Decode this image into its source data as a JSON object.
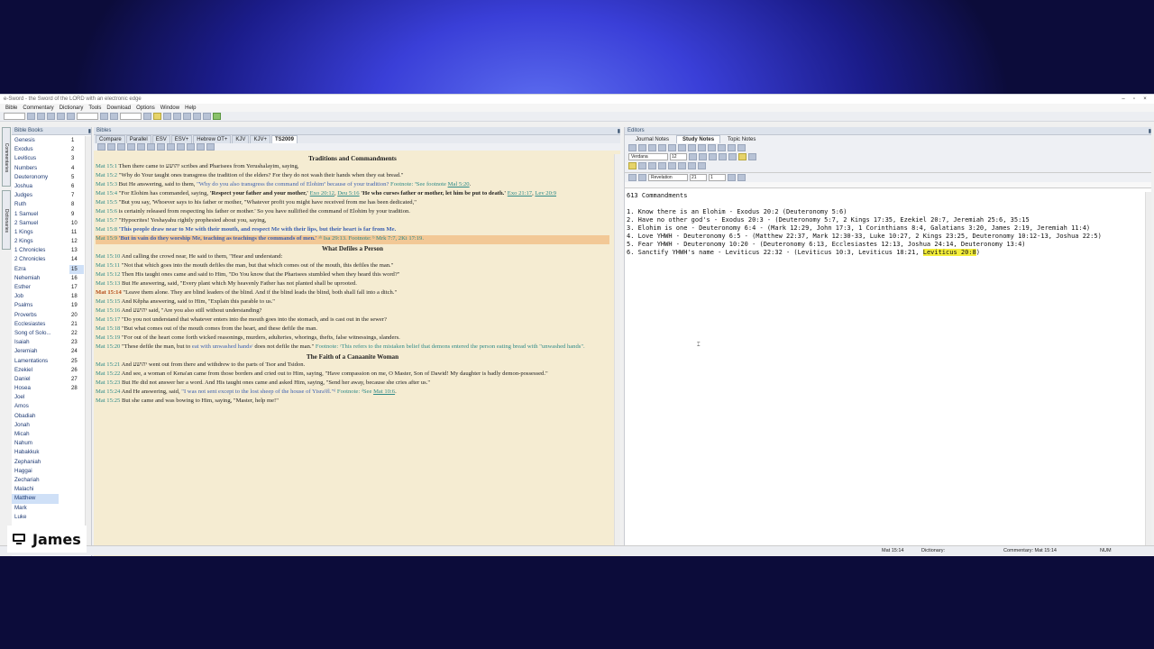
{
  "window": {
    "title": "e-Sword - the Sword of the LORD with an electronic edge"
  },
  "menu": [
    "Bible",
    "Commentary",
    "Dictionary",
    "Tools",
    "Download",
    "Options",
    "Window",
    "Help"
  ],
  "side_tabs": [
    "Commentaries",
    "Dictionaries"
  ],
  "books_panel": {
    "title": "Bible Books",
    "books": [
      "Genesis",
      "Exodus",
      "Leviticus",
      "Numbers",
      "Deuteronomy",
      "Joshua",
      "Judges",
      "Ruth",
      "1 Samuel",
      "2 Samuel",
      "1 Kings",
      "2 Kings",
      "1 Chronicles",
      "2 Chronicles",
      "Ezra",
      "Nehemiah",
      "Esther",
      "Job",
      "Psalms",
      "Proverbs",
      "Ecclesiastes",
      "Song of Solo...",
      "Isaiah",
      "Jeremiah",
      "Lamentations",
      "Ezekiel",
      "Daniel",
      "Hosea",
      "Joel",
      "Amos",
      "Obadiah",
      "Jonah",
      "Micah",
      "Nahum",
      "Habakkuk",
      "Zephaniah",
      "Haggai",
      "Zechariah",
      "Malachi",
      "Matthew",
      "Mark",
      "Luke"
    ],
    "selected_book": "Matthew",
    "chapters": [
      "1",
      "2",
      "3",
      "4",
      "5",
      "6",
      "7",
      "8",
      "9",
      "10",
      "11",
      "12",
      "13",
      "14",
      "15",
      "16",
      "17",
      "18",
      "19",
      "20",
      "21",
      "22",
      "23",
      "24",
      "25",
      "26",
      "27",
      "28"
    ],
    "selected_chapter": "15"
  },
  "bibles_panel": {
    "title": "Bibles",
    "tabs": [
      "Compare",
      "Parallel",
      "ESV",
      "ESV+",
      "Hebrew OT+",
      "KJV",
      "KJV+",
      "TS2009"
    ],
    "active_tab": "TS2009"
  },
  "passage": {
    "heading1": "Traditions and Commandments",
    "v1": {
      "ref": "Mat 15:1",
      "text": "Then there came to יהושע scribes and Pharisees from Yerushalayim, saying,"
    },
    "v2": {
      "ref": "Mat 15:2",
      "text": "\"Why do Your taught ones transgress the tradition of the elders? For they do not wash their hands when they eat bread.\""
    },
    "v3": {
      "ref": "Mat 15:3",
      "text": "But He answering, said to them,",
      "quote": "\"Why do you also transgress the command of Elohimª because of your tradition?",
      "fn_label": "Footnote:",
      "fn": "ªSee footnote",
      "fn_ref": "Mal 5:20",
      "fn_end": "."
    },
    "v4": {
      "ref": "Mat 15:4",
      "text": "\"For Elohim has commanded, saying,",
      "bold": "'Respect your father and your mother,'",
      "x1": "Exo 20:12",
      "x2": "Deu 5:16",
      "bold2": "'He who curses father or mother, let him be put to death.'",
      "x3": "Exo 21:17",
      "x4": "Lev 20:9"
    },
    "v5": {
      "ref": "Mat 15:5",
      "text": "\"But you say, 'Whoever says to his father or mother, \"Whatever profit you might have received from me has been dedicated,\""
    },
    "v6": {
      "ref": "Mat 15:6",
      "text": "is certainly released from respecting his father or mother.' So you have nullified the command of Elohim by your tradition."
    },
    "v7": {
      "ref": "Mat 15:7",
      "text": "\"Hypocrites! Yeshayahu rightly prophesied about you, saying,"
    },
    "v8": {
      "ref": "Mat 15:8",
      "text": "'This people draw near to Me with their mouth, and respect Me with their lips, but their heart is far from Me."
    },
    "v9": {
      "ref": "Mat 15:9",
      "text": "'But in vain do they worship Me, teaching as teachings the commands of men.'",
      "fn": "ᵃᵇ Isa 29:13. Footnote: ᵇ Mrk 7:7, 2Ki 17:19."
    },
    "heading2": "What Defiles a Person",
    "v10": {
      "ref": "Mat 15:10",
      "text": "And calling the crowd near, He said to them, \"Hear and understand:"
    },
    "v11": {
      "ref": "Mat 15:11",
      "text": "\"Not that which goes into the mouth defiles the man, but that which comes out of the mouth, this defiles the man.\""
    },
    "v12": {
      "ref": "Mat 15:12",
      "text": "Then His taught ones came and said to Him, \"Do You know that the Pharisees stumbled when they heard this word?\""
    },
    "v13": {
      "ref": "Mat 15:13",
      "text": "But He answering, said, \"Every plant which My heavenly Father has not planted shall be uprooted."
    },
    "v14": {
      "ref": "Mat 15:14",
      "text": "\"Leave them alone. They are blind leaders of the blind. And if the blind leads the blind, both shall fall into a ditch.\""
    },
    "v15": {
      "ref": "Mat 15:15",
      "text": "And Kĕpha answering, said to Him, \"Explain this parable to us.\""
    },
    "v16": {
      "ref": "Mat 15:16",
      "text": "And יהושע said, \"Are you also still without understanding?"
    },
    "v17": {
      "ref": "Mat 15:17",
      "text": "\"Do you not understand that whatever enters into the mouth goes into the stomach, and is cast out in the sewer?"
    },
    "v18": {
      "ref": "Mat 15:18",
      "text": "\"But what comes out of the mouth comes from the heart, and these defile the man."
    },
    "v19": {
      "ref": "Mat 15:19",
      "text": "\"For out of the heart come forth wicked reasonings, murders, adulteries, whorings, thefts, false witnessings, slanders."
    },
    "v20": {
      "ref": "Mat 15:20",
      "text": "\"These defile the man, but to",
      "blue": "eat with unwashed handsᶜ",
      "text2": "does not defile the man.\"",
      "fn": "Footnote: ᶜThis refers to the mistaken belief that demons entered the person eating bread with \"unwashed hands\"."
    },
    "heading3": "The Faith of a Canaanite Woman",
    "v21": {
      "ref": "Mat 15:21",
      "text": "And יהושע went out from there and withdrew to the parts of Tsor and Tsidon."
    },
    "v22": {
      "ref": "Mat 15:22",
      "text": "And see, a woman of Kena'an came from those borders and cried out to Him, saying, \"Have compassion on me, O Master, Son of Dawid! My daughter is badly demon-possessed.\""
    },
    "v23": {
      "ref": "Mat 15:23",
      "text": "But He did not answer her a word. And His taught ones came and asked Him, saying, \"Send her away, because she cries after us.\""
    },
    "v24": {
      "ref": "Mat 15:24",
      "text": "And He answering, said,",
      "blue": "\"I was not sent except to the lost sheep of the house of Yisra'ĕl.\"ᵈ",
      "fn": "Footnote: ᵈSee",
      "fn_ref": "Mat 10:6",
      "fn_end": "."
    },
    "v25": {
      "ref": "Mat 15:25",
      "text": "But she came and was bowing to Him, saying, \"Master, help me!\""
    }
  },
  "editors_panel": {
    "title": "Editors",
    "tabs": [
      "Journal Notes",
      "Study Notes",
      "Topic Notes"
    ],
    "active_tab": "Study Notes",
    "font": "Verdana",
    "font_size": "12",
    "book_select": "Revelation",
    "chapter_select": "21",
    "verse_select": "1",
    "notes_title": "613 Commandments",
    "notes": [
      "1. Know there is an Elohim - Exodus 20:2 (Deuteronomy 5:6)",
      "2. Have no other god's - Exodus 20:3 - (Deuteronomy 5:7, 2 Kings 17:35, Ezekiel 20:7, Jeremiah 25:6, 35:15",
      "3. Elohim is one - Deuteronomy 6:4 - (Mark 12:29, John 17:3, 1 Corinthians 8:4, Galatians 3:20, James 2:19, Jeremiah 11:4)",
      "4. Love YHWH - Deuteronomy 6:5 - (Matthew 22:37, Mark 12:30-33, Luke 10:27, 2 Kings 23:25, Deuteronomy 10:12-13, Joshua 22:5)",
      "5. Fear YHWH - Deuteronomy 10:20 - (Deuteronomy 6:13, Ecclesiastes 12:13, Joshua 24:14, Deuteronomy 13:4)"
    ],
    "note6_prefix": "6. Sanctify YHWH's name - Leviticus 22:32 - (Leviticus 10:3, Leviticus 18:21, ",
    "note6_highlight": "Leviticus 20:8",
    "note6_suffix": ")",
    "highlight_color": "#f4ee3a"
  },
  "status": {
    "ref": "Mat 15:14",
    "dictionary": "Dictionary:",
    "commentary": "Commentary: Mat 15:14",
    "num": "NUM"
  },
  "presenter": {
    "name": "James"
  }
}
